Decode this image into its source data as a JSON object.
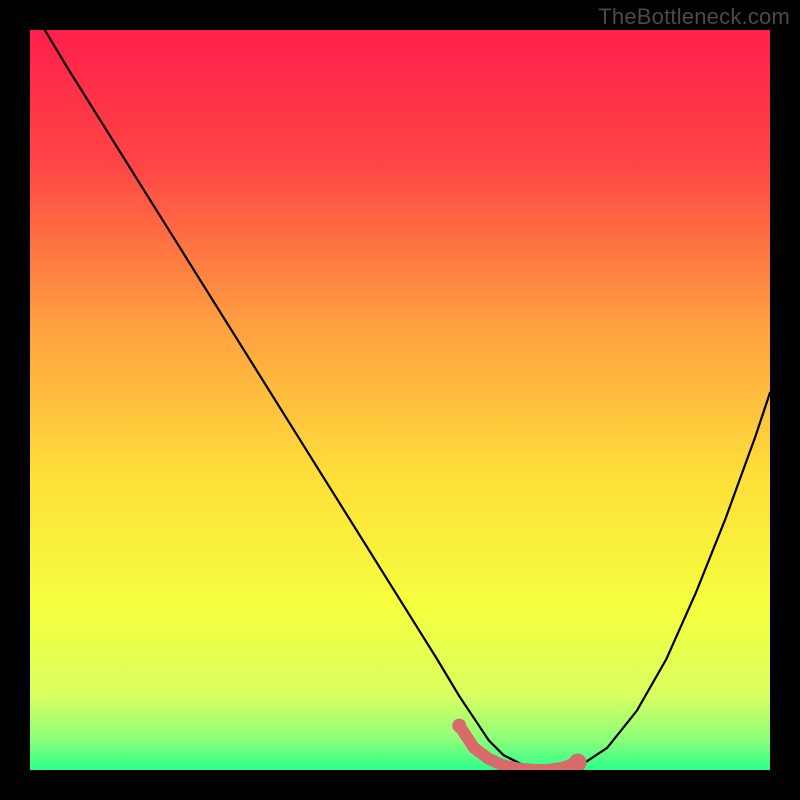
{
  "watermark": "TheBottleneck.com",
  "chart_data": {
    "type": "line",
    "title": "",
    "xlabel": "",
    "ylabel": "",
    "xlim": [
      0,
      100
    ],
    "ylim": [
      0,
      100
    ],
    "background_gradient": {
      "stops": [
        {
          "offset": 0.0,
          "color": "#ff1f4b"
        },
        {
          "offset": 0.18,
          "color": "#ff4545"
        },
        {
          "offset": 0.4,
          "color": "#ffa040"
        },
        {
          "offset": 0.6,
          "color": "#ffde3a"
        },
        {
          "offset": 0.78,
          "color": "#f5ff3e"
        },
        {
          "offset": 0.9,
          "color": "#d8ff60"
        },
        {
          "offset": 0.96,
          "color": "#8aff7a"
        },
        {
          "offset": 1.0,
          "color": "#2bff8a"
        }
      ]
    },
    "series": [
      {
        "name": "bottleneck-curve",
        "x": [
          2,
          5,
          10,
          15,
          20,
          25,
          30,
          35,
          40,
          45,
          50,
          55,
          58,
          60,
          62,
          64,
          66,
          68,
          70,
          72,
          75,
          78,
          82,
          86,
          90,
          94,
          98,
          100
        ],
        "y": [
          100,
          95,
          87,
          79,
          71,
          63,
          55,
          47,
          39,
          31,
          23,
          15,
          10,
          7,
          4,
          2,
          1,
          0,
          0,
          0,
          1,
          3,
          8,
          15,
          24,
          34,
          45,
          51
        ]
      }
    ],
    "highlight": {
      "name": "optimal-range",
      "x": [
        58,
        60,
        62,
        64,
        66,
        68,
        70,
        72,
        74
      ],
      "y": [
        6,
        3,
        1.5,
        0.6,
        0.2,
        0,
        0,
        0.3,
        1
      ],
      "color": "#d96a6a"
    }
  }
}
